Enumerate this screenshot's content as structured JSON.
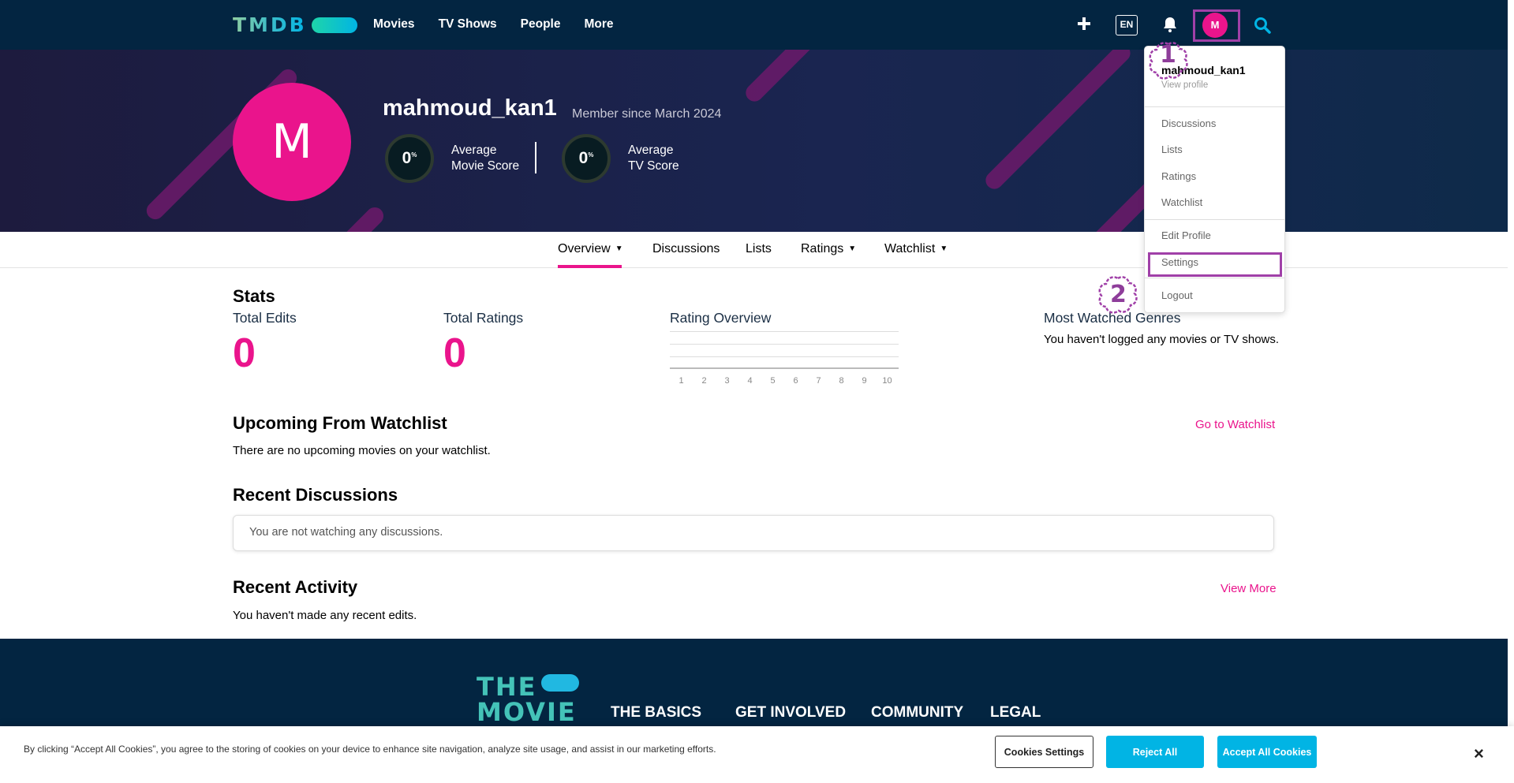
{
  "colors": {
    "nav_bg": "#032541",
    "accent_pink": "#ea148c",
    "accent_blue": "#01b4e4",
    "annotation": "#a040a8"
  },
  "nav": {
    "logo": "TMDB",
    "links": [
      "Movies",
      "TV Shows",
      "People",
      "More"
    ],
    "lang": "EN",
    "avatar_letter": "M",
    "icons": [
      "plus-icon",
      "bell-icon",
      "search-icon"
    ]
  },
  "profile": {
    "avatar_letter": "M",
    "username": "mahmoud_kan1",
    "member_since": "Member since March 2024",
    "movie_score": {
      "value": "0",
      "unit": "%",
      "line1": "Average",
      "line2": "Movie Score"
    },
    "tv_score": {
      "value": "0",
      "unit": "%",
      "line1": "Average",
      "line2": "TV Score"
    }
  },
  "subnav": {
    "items": [
      {
        "label": "Overview",
        "caret": "▼"
      },
      {
        "label": "Discussions"
      },
      {
        "label": "Lists"
      },
      {
        "label": "Ratings",
        "caret": "▼"
      },
      {
        "label": "Watchlist",
        "caret": "▼"
      }
    ]
  },
  "stats": {
    "title": "Stats",
    "total_edits_label": "Total Edits",
    "total_edits_value": "0",
    "total_ratings_label": "Total Ratings",
    "total_ratings_value": "0",
    "rating_overview_label": "Rating Overview",
    "rating_ticks": [
      "1",
      "2",
      "3",
      "4",
      "5",
      "6",
      "7",
      "8",
      "9",
      "10"
    ],
    "genres_label": "Most Watched Genres",
    "genres_empty": "You haven't logged any movies or TV shows."
  },
  "watchlist": {
    "title": "Upcoming From Watchlist",
    "empty": "There are no upcoming movies on your watchlist.",
    "link": "Go to Watchlist"
  },
  "discussions": {
    "title": "Recent Discussions",
    "empty": "You are not watching any discussions."
  },
  "activity": {
    "title": "Recent Activity",
    "empty": "You haven't made any recent edits.",
    "link": "View More"
  },
  "footer": {
    "logo_line1": "THE",
    "logo_line2": "MOVIE",
    "columns": [
      "THE BASICS",
      "GET INVOLVED",
      "COMMUNITY",
      "LEGAL"
    ]
  },
  "cookies": {
    "text": "By clicking “Accept All Cookies”, you agree to the storing of cookies on your device to enhance site navigation, analyze site usage, and assist in our marketing efforts.",
    "settings_label": "Cookies Settings",
    "reject_label": "Reject All",
    "accept_label": "Accept All Cookies",
    "close_label": "×"
  },
  "dropdown": {
    "username": "mahmoud_kan1",
    "view_profile": "View profile",
    "items_group1": [
      "Discussions",
      "Lists",
      "Ratings",
      "Watchlist"
    ],
    "edit_profile": "Edit Profile",
    "settings": "Settings",
    "logout": "Logout"
  },
  "annotations": [
    "1",
    "2"
  ]
}
